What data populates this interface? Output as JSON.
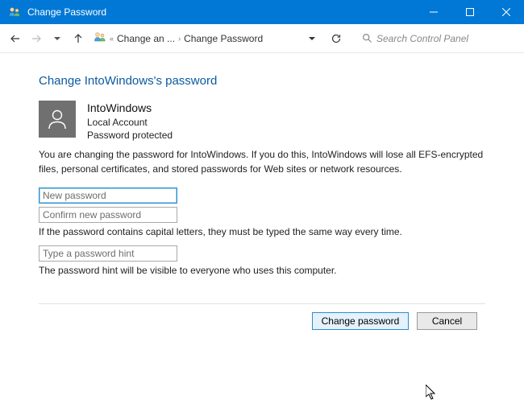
{
  "window": {
    "title": "Change Password"
  },
  "nav": {
    "breadcrumb1": "Change an ...",
    "breadcrumb2": "Change Password"
  },
  "search": {
    "placeholder": "Search Control Panel"
  },
  "page": {
    "heading": "Change IntoWindows's password",
    "user": {
      "name": "IntoWindows",
      "type": "Local Account",
      "status": "Password protected"
    },
    "warning": "You are changing the password for IntoWindows.  If you do this, IntoWindows will lose all EFS-encrypted files, personal certificates, and stored passwords for Web sites or network resources.",
    "fields": {
      "new_password_placeholder": "New password",
      "confirm_password_placeholder": "Confirm new password",
      "caps_note": "If the password contains capital letters, they must be typed the same way every time.",
      "hint_placeholder": "Type a password hint",
      "hint_note": "The password hint will be visible to everyone who uses this computer."
    },
    "buttons": {
      "change": "Change password",
      "cancel": "Cancel"
    }
  }
}
